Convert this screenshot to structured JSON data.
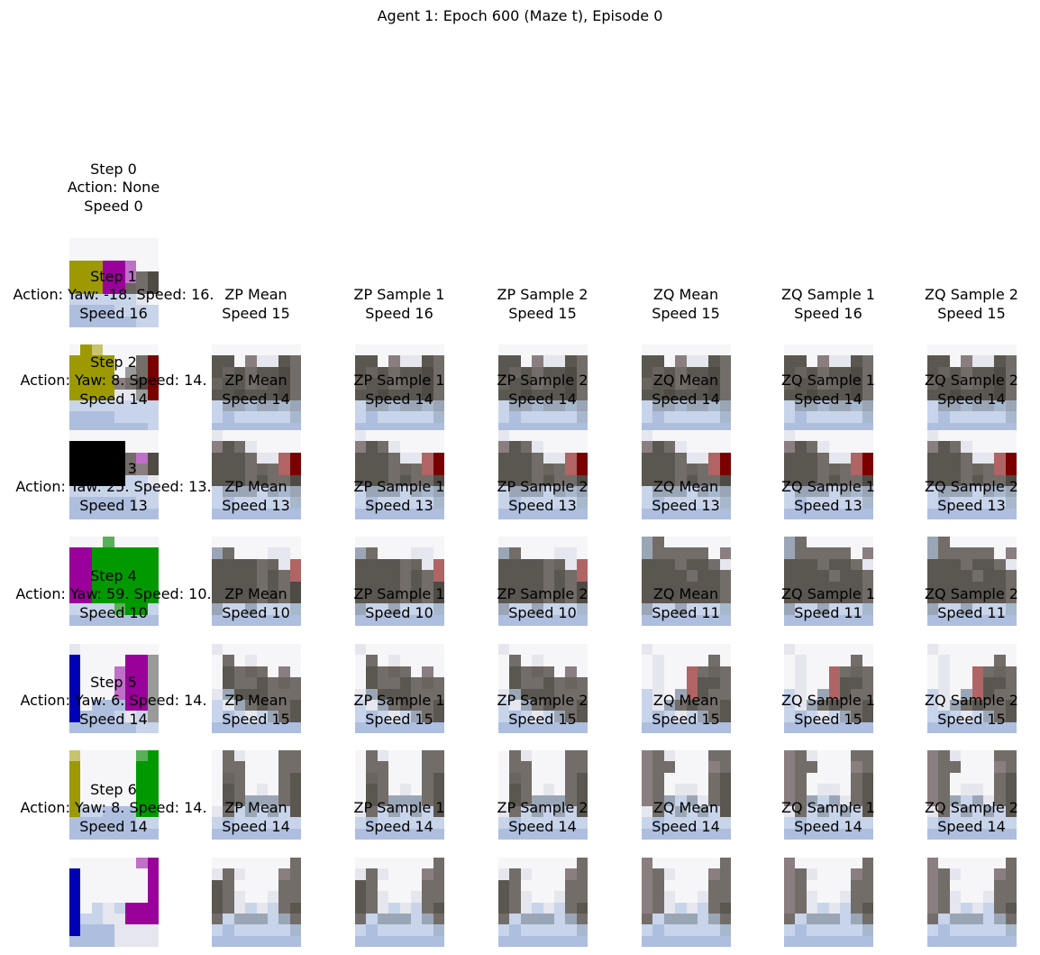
{
  "figure_title": "Agent 1: Epoch 600 (Maze t), Episode 0",
  "step0": {
    "step": "Step 0",
    "action": "Action: None",
    "speed": "Speed 0"
  },
  "column_titles": [
    "ZP Mean",
    "ZP Sample 1",
    "ZP Sample 2",
    "ZQ Mean",
    "ZQ Sample 1",
    "ZQ Sample 2"
  ],
  "rows": [
    {
      "step": "Step 1",
      "action": "Action: Yaw: -18. Speed: 16.",
      "speed": "Speed 16",
      "pred_speeds": [
        "Speed 15",
        "Speed 16",
        "Speed 15",
        "Speed 15",
        "Speed 16",
        "Speed 15"
      ]
    },
    {
      "step": "Step 2",
      "action": "Action: Yaw: 8. Speed: 14.",
      "speed": "Speed 14",
      "pred_speeds": [
        "Speed 14",
        "Speed 14",
        "Speed 14",
        "Speed 14",
        "Speed 14",
        "Speed 14"
      ]
    },
    {
      "step": "Step 3",
      "action": "Action: Yaw: 25. Speed: 13.",
      "speed": "Speed 13",
      "pred_speeds": [
        "Speed 13",
        "Speed 13",
        "Speed 13",
        "Speed 13",
        "Speed 13",
        "Speed 13"
      ]
    },
    {
      "step": "Step 4",
      "action": "Action: Yaw: 59. Speed: 10.",
      "speed": "Speed 10",
      "pred_speeds": [
        "Speed 10",
        "Speed 10",
        "Speed 10",
        "Speed 11",
        "Speed 11",
        "Speed 11"
      ]
    },
    {
      "step": "Step 5",
      "action": "Action: Yaw: 6. Speed: 14.",
      "speed": "Speed 14",
      "pred_speeds": [
        "Speed 15",
        "Speed 15",
        "Speed 15",
        "Speed 15",
        "Speed 15",
        "Speed 15"
      ]
    },
    {
      "step": "Step 6",
      "action": "Action: Yaw: 8. Speed: 14.",
      "speed": "Speed 14",
      "pred_speeds": [
        "Speed 14",
        "Speed 14",
        "Speed 14",
        "Speed 14",
        "Speed 14",
        "Speed 14"
      ]
    }
  ],
  "colors": {
    "yellow": "#9c9a00",
    "magenta": "#9a009a",
    "green": "#009a00",
    "blue": "#0000b4",
    "gray_dark": "#5a5650",
    "floor": "#aebede",
    "white": "#f6f6f8"
  }
}
